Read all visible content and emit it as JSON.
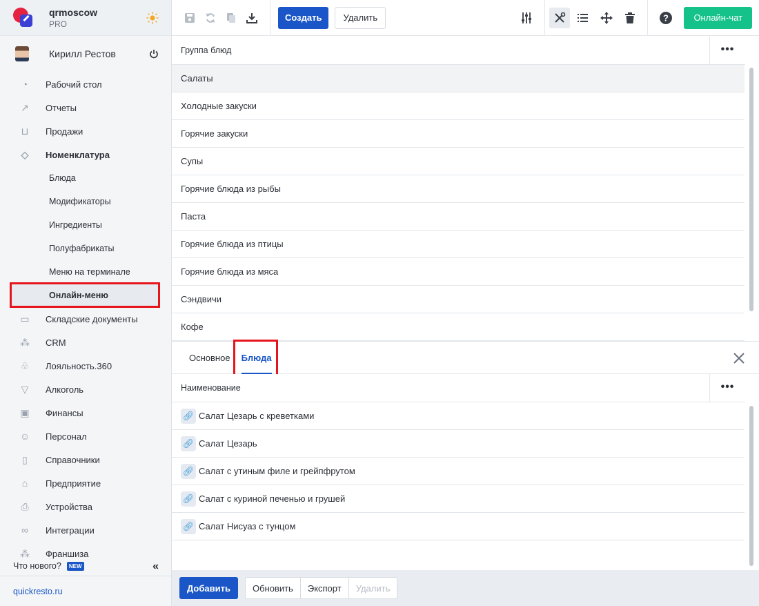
{
  "brand": {
    "name": "qrmoscow",
    "plan": "PRO"
  },
  "user": {
    "name": "Кирилл Рестов"
  },
  "nav": {
    "items": [
      {
        "label": "Рабочий стол",
        "icon": "dashboard-icon"
      },
      {
        "label": "Отчеты",
        "icon": "chart-icon"
      },
      {
        "label": "Продажи",
        "icon": "basket-icon"
      },
      {
        "label": "Номенклатура",
        "icon": "tag-icon"
      }
    ],
    "sub": [
      "Блюда",
      "Модификаторы",
      "Ингредиенты",
      "Полуфабрикаты",
      "Меню на терминале",
      "Онлайн-меню"
    ],
    "items2": [
      {
        "label": "Складские документы",
        "icon": "box-icon"
      },
      {
        "label": "CRM",
        "icon": "hierarchy-icon"
      },
      {
        "label": "Лояльность.360",
        "icon": "loyalty-icon"
      },
      {
        "label": "Алкоголь",
        "icon": "glass-icon"
      },
      {
        "label": "Финансы",
        "icon": "wallet-icon"
      },
      {
        "label": "Персонал",
        "icon": "people-icon"
      },
      {
        "label": "Справочники",
        "icon": "book-icon"
      },
      {
        "label": "Предприятие",
        "icon": "store-icon"
      },
      {
        "label": "Устройства",
        "icon": "printer-icon"
      },
      {
        "label": "Интеграции",
        "icon": "infinity-icon"
      },
      {
        "label": "Франшиза",
        "icon": "hierarchy-icon"
      }
    ],
    "whats_new": "Что нового?",
    "new_badge": "NEW",
    "site": "quickresto.ru"
  },
  "toolbar": {
    "create": "Создать",
    "delete": "Удалить",
    "chat": "Онлайн-чат"
  },
  "upper_table": {
    "header": "Группа блюд",
    "rows": [
      "Салаты",
      "Холодные закуски",
      "Горячие закуски",
      "Супы",
      "Горячие блюда из рыбы",
      "Паста",
      "Горячие блюда из птицы",
      "Горячие блюда из мяса",
      "Сэндвичи",
      "Кофе"
    ]
  },
  "tabs": {
    "main": "Основное",
    "dishes": "Блюда"
  },
  "lower_table": {
    "header": "Наименование",
    "rows": [
      "Салат Цезарь с креветками",
      "Салат Цезарь",
      "Салат с утиным филе и грейпфрутом",
      "Салат с куриной печенью и грушей",
      "Салат Нисуаз с тунцом"
    ]
  },
  "footer": {
    "add": "Добавить",
    "refresh": "Обновить",
    "export": "Экспорт",
    "delete": "Удалить"
  },
  "colors": {
    "accent": "#1a56c8",
    "highlight": "#e6141b",
    "chat": "#15c28a"
  }
}
